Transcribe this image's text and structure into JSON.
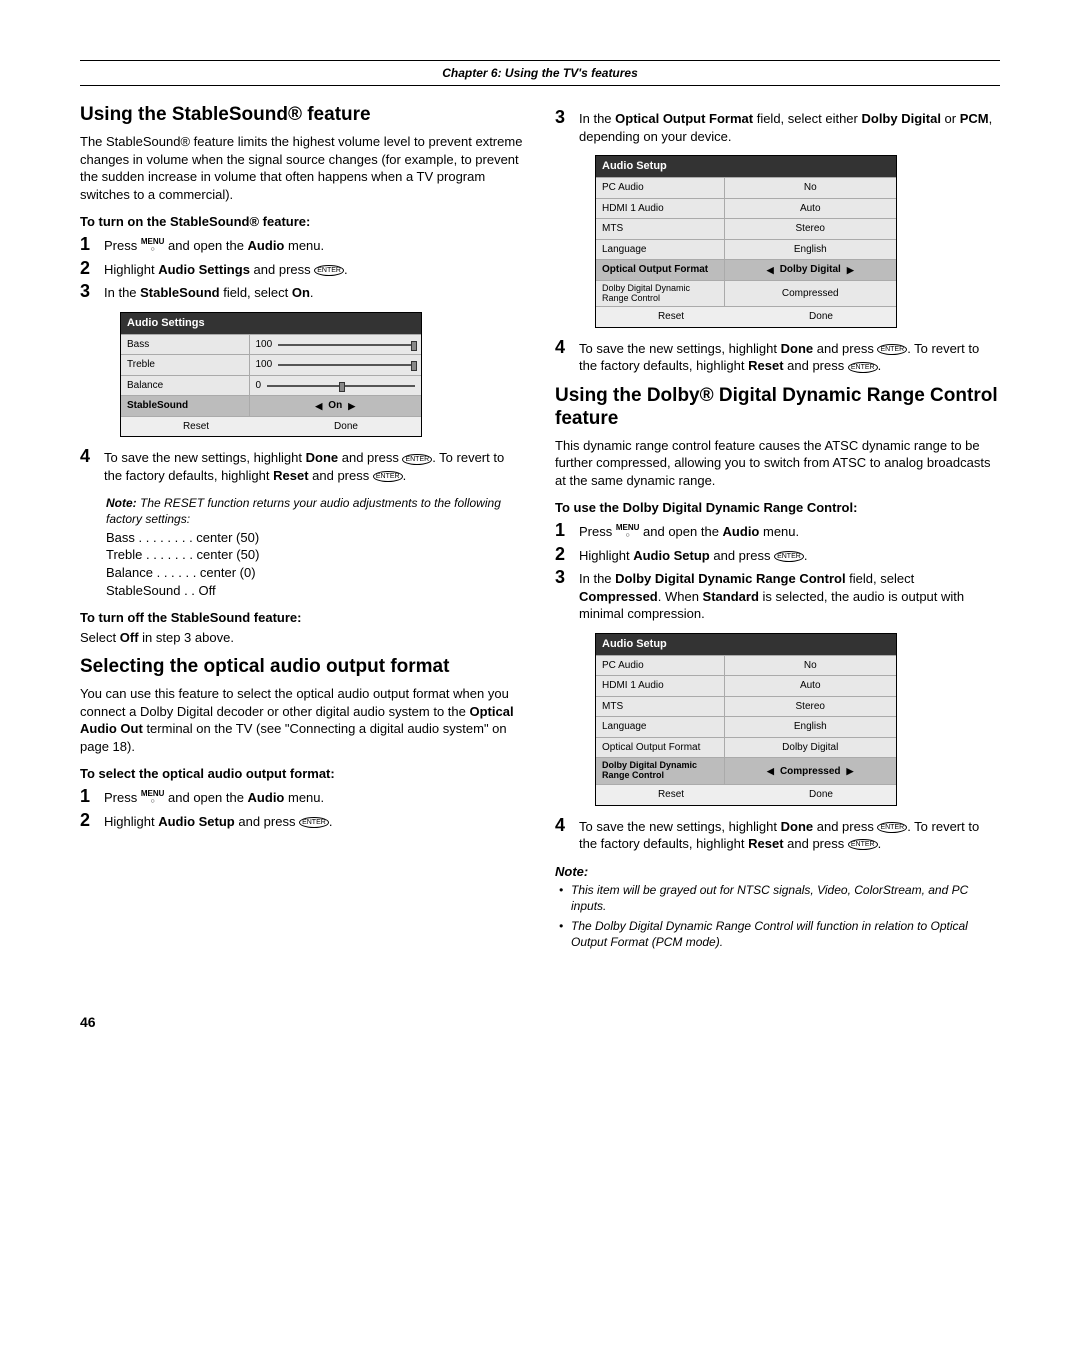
{
  "chapter_header": "Chapter 6: Using the TV's features",
  "page_number": "46",
  "left": {
    "h_stable": "Using the StableSound® feature",
    "p_stable": "The StableSound® feature limits the highest volume level to prevent extreme changes in volume when the signal source changes (for example, to prevent the sudden increase in volume that often happens when a TV program switches to a commercial).",
    "turn_on_head": "To turn on the StableSound® feature:",
    "steps_on": {
      "s1a": "Press ",
      "s1b": " and open the ",
      "s1c": "Audio",
      "s1d": " menu.",
      "s2a": "Highlight ",
      "s2b": "Audio Settings",
      "s2c": " and press ",
      "s3a": "In the ",
      "s3b": "StableSound",
      "s3c": " field, select ",
      "s3d": "On",
      "s3e": "."
    },
    "panel_settings": {
      "title": "Audio Settings",
      "rows": [
        {
          "l": "Bass",
          "r": "100",
          "slider": true
        },
        {
          "l": "Treble",
          "r": "100",
          "slider": true
        },
        {
          "l": "Balance",
          "r": "0",
          "slider": "center"
        },
        {
          "l": "StableSound",
          "r": "On",
          "hl": true,
          "arrows": true
        }
      ],
      "foot_l": "Reset",
      "foot_r": "Done"
    },
    "s4a": "To save the new settings, highlight ",
    "s4b": "Done",
    "s4c": " and press ",
    "s4d": ". To revert to the factory defaults, highlight ",
    "s4e": "Reset",
    "s4f": " and press ",
    "note_label": "Note:",
    "note_text": " The RESET function returns your audio adjustments to the following factory settings:",
    "reset_list": [
      "Bass  . . . . . . . .  center (50)",
      "Treble  . . . . . . .  center (50)",
      "Balance  . . . . . .  center (0)",
      "StableSound  . .  Off"
    ],
    "turn_off_head": "To turn off the StableSound feature:",
    "turn_off_body_a": "Select ",
    "turn_off_body_b": "Off",
    "turn_off_body_c": " in step 3 above.",
    "h_optical": "Selecting the optical audio output format",
    "p_optical_a": "You can use this feature to select the optical audio output format when you connect a Dolby Digital decoder or other digital audio system to the ",
    "p_optical_b": "Optical Audio Out",
    "p_optical_c": " terminal on the TV (see \"Connecting a digital audio system\" on page 18).",
    "select_head": "To select the optical audio output format:",
    "opt_steps": {
      "s1a": "Press ",
      "s1b": " and open the ",
      "s1c": "Audio",
      "s1d": " menu.",
      "s2a": "Highlight ",
      "s2b": "Audio Setup",
      "s2c": " and press "
    }
  },
  "right": {
    "s3a": "In the ",
    "s3b": "Optical Output Format",
    "s3c": " field, select either ",
    "s3d": "Dolby Digital",
    "s3e": " or ",
    "s3f": "PCM",
    "s3g": ", depending on your device.",
    "panel_setup1": {
      "title": "Audio Setup",
      "rows": [
        {
          "l": "PC Audio",
          "r": "No"
        },
        {
          "l": "HDMI 1 Audio",
          "r": "Auto"
        },
        {
          "l": "MTS",
          "r": "Stereo"
        },
        {
          "l": "Language",
          "r": "English"
        },
        {
          "l": "Optical Output Format",
          "r": "Dolby Digital",
          "hl": true,
          "arrows": true
        },
        {
          "l": "Dolby Digital Dynamic Range Control",
          "r": "Compressed"
        }
      ],
      "foot_l": "Reset",
      "foot_r": "Done"
    },
    "s4a": "To save the new settings, highlight ",
    "s4b": "Done",
    "s4c": " and press ",
    "s4d": ". To revert to the factory defaults, highlight ",
    "s4e": "Reset",
    "s4f": " and press ",
    "h_dolby": "Using the Dolby® Digital Dynamic Range Control feature",
    "p_dolby": "This dynamic range control feature causes the ATSC dynamic range to be further compressed, allowing you to switch from ATSC to analog broadcasts at the same dynamic range.",
    "use_head": "To use the Dolby Digital Dynamic Range Control:",
    "dolby_steps": {
      "s1a": "Press ",
      "s1b": " and open the ",
      "s1c": "Audio",
      "s1d": " menu.",
      "s2a": "Highlight ",
      "s2b": "Audio Setup",
      "s2c": " and press ",
      "s3a": "In the ",
      "s3b": "Dolby Digital Dynamic Range Control",
      "s3c": " field, select ",
      "s3d": "Compressed",
      "s3e": ". When ",
      "s3f": "Standard",
      "s3g": " is selected, the audio is output with minimal compression."
    },
    "panel_setup2": {
      "title": "Audio Setup",
      "rows": [
        {
          "l": "PC Audio",
          "r": "No"
        },
        {
          "l": "HDMI 1 Audio",
          "r": "Auto"
        },
        {
          "l": "MTS",
          "r": "Stereo"
        },
        {
          "l": "Language",
          "r": "English"
        },
        {
          "l": "Optical Output Format",
          "r": "Dolby Digital"
        },
        {
          "l": "Dolby Digital Dynamic Range Control",
          "r": "Compressed",
          "hl": true,
          "arrows": true
        }
      ],
      "foot_l": "Reset",
      "foot_r": "Done"
    },
    "d4a": "To save the new settings, highlight ",
    "d4b": "Done",
    "d4c": " and press ",
    "d4d": ". To revert to the factory defaults, highlight ",
    "d4e": "Reset",
    "d4f": " and press ",
    "note2_label": "Note:",
    "note2_items": [
      "This item will be grayed out for NTSC signals, Video, ColorStream, and PC inputs.",
      "The Dolby Digital Dynamic Range Control will function in relation to Optical Output Format (PCM mode)."
    ]
  },
  "icons": {
    "menu": "MENU",
    "enter": "ENTER"
  }
}
